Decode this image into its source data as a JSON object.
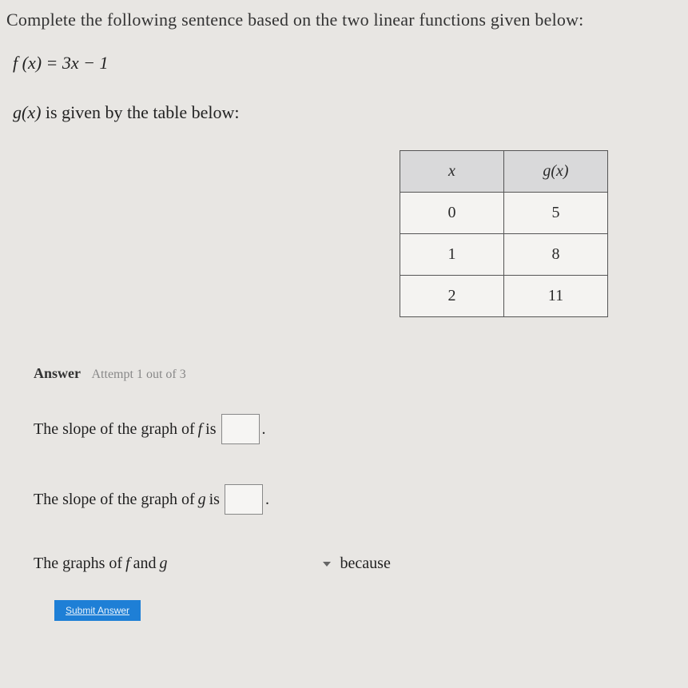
{
  "prompt": "Complete the following sentence based on the two linear functions given below:",
  "f_equation": "f (x) = 3x − 1",
  "g_description_prefix": "g(x)",
  "g_description_suffix": " is given by the table below:",
  "table": {
    "header_x": "x",
    "header_gx": "g(x)",
    "rows": [
      {
        "x": "0",
        "gx": "5"
      },
      {
        "x": "1",
        "gx": "8"
      },
      {
        "x": "2",
        "gx": "11"
      }
    ]
  },
  "answer_label": "Answer",
  "attempt_text": "Attempt 1 out of 3",
  "slope_f_prefix": "The slope of the graph of ",
  "slope_f_fn": "f",
  "slope_f_suffix": " is",
  "slope_f_period": ".",
  "slope_g_prefix": "The slope of the graph of ",
  "slope_g_fn": "g",
  "slope_g_suffix": " is",
  "slope_g_period": ".",
  "graphs_prefix": "The graphs of ",
  "graphs_f": "f",
  "graphs_and": " and ",
  "graphs_g": "g",
  "graphs_because": "because",
  "submit_label": "Submit Answer",
  "chart_data": {
    "type": "table",
    "title": "g(x) values",
    "columns": [
      "x",
      "g(x)"
    ],
    "rows": [
      [
        0,
        5
      ],
      [
        1,
        8
      ],
      [
        2,
        11
      ]
    ]
  }
}
